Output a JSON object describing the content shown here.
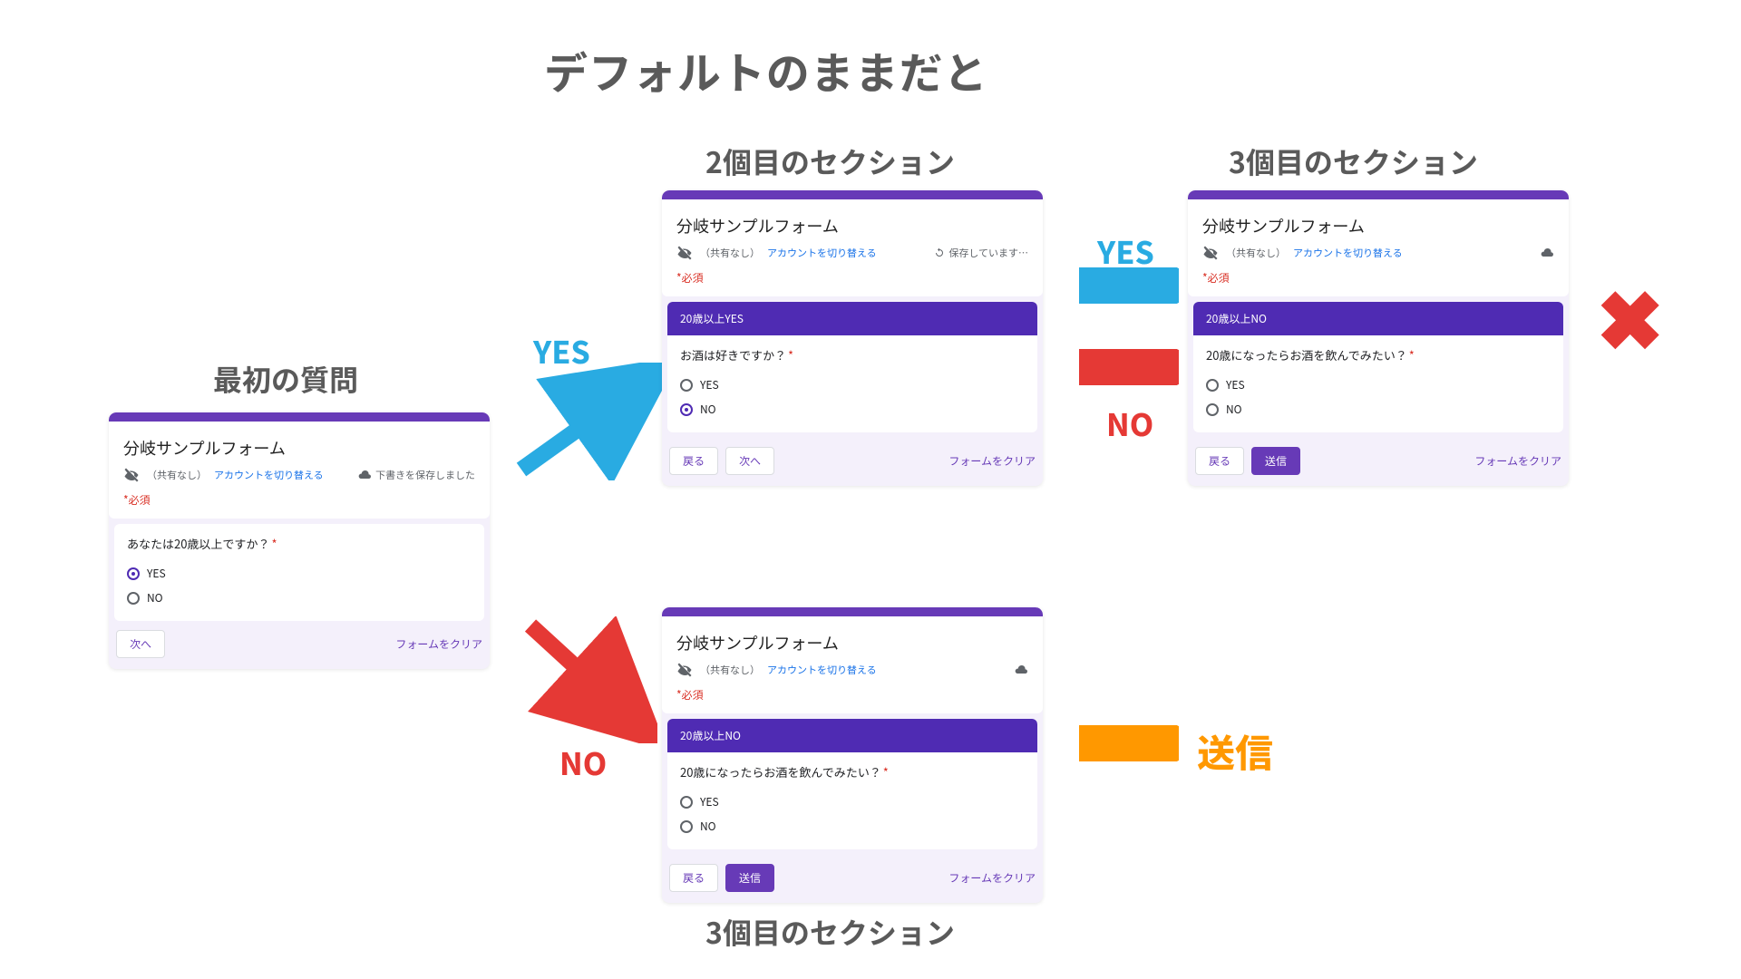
{
  "colors": {
    "purple": "#673ab7",
    "deepPurple": "#4f2bb3",
    "blue": "#29abe2",
    "red": "#e53935",
    "orange": "#ff9800"
  },
  "title": "デフォルトのままだと",
  "labels": {
    "first": "最初の質問",
    "section2": "2個目のセクション",
    "section3": "3個目のセクション",
    "section3_dup": "3個目のセクション",
    "yes_arrow": "YES",
    "no_arrow": "NO",
    "submit": "送信"
  },
  "form_shared": {
    "title": "分岐サンプルフォーム",
    "share_note": "（共有なし）",
    "switch_account": "アカウントを切り替える",
    "required": "*必須",
    "clear_form": "フォームをクリア",
    "btn_back": "戻る",
    "btn_next": "次へ",
    "btn_submit": "送信",
    "opt_yes": "YES",
    "opt_no": "NO"
  },
  "card_first": {
    "save_status": "下書きを保存しました",
    "question": "あなたは20歳以上ですか？",
    "selected": "yes"
  },
  "card_sec2": {
    "save_status": "保存しています…",
    "section_header": "20歳以上YES",
    "question": "お酒は好きですか？",
    "selected": "no"
  },
  "card_sec3_top": {
    "section_header": "20歳以上NO",
    "question": "20歳になったらお酒を飲んでみたい？",
    "selected": null
  },
  "card_sec3_bottom": {
    "section_header": "20歳以上NO",
    "question": "20歳になったらお酒を飲んでみたい？",
    "selected": null
  }
}
